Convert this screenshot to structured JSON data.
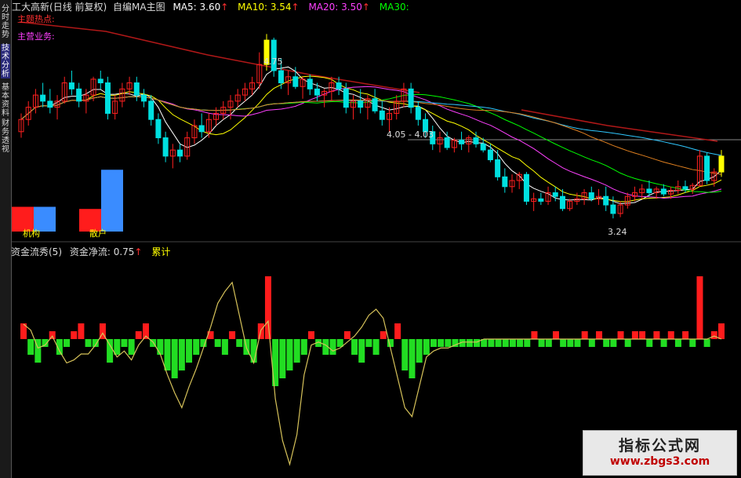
{
  "sidebar": {
    "tabs": [
      "分时走势",
      "技术分析",
      "基本资料",
      "财务透视"
    ]
  },
  "header": {
    "stock": "工大高新",
    "period": "(日线 前复权)",
    "indicator": "自编MA主图",
    "ma": [
      {
        "name": "MA5:",
        "value": "3.60",
        "arrow": "↑",
        "color": "#ffffff"
      },
      {
        "name": "MA10:",
        "value": "3.54",
        "arrow": "↑",
        "color": "#ffff00"
      },
      {
        "name": "MA20:",
        "value": "3.50",
        "arrow": "↑",
        "color": "#ff40ff"
      },
      {
        "name": "MA30:",
        "value": "",
        "arrow": "",
        "color": "#00ff00"
      }
    ]
  },
  "notes": {
    "line1": "主题热点:",
    "line2": "主营业务:"
  },
  "price_labels": {
    "high": "4.75",
    "mid": "4.05 - 4.03",
    "low": "3.24"
  },
  "volume_legend": {
    "institution": "机构",
    "retail": "散户"
  },
  "lower_header": {
    "title": "资金流秀(5)",
    "net_label": "资金净流:",
    "net_value": "0.75",
    "arrow": "↑",
    "cum_label": "累计"
  },
  "watermark": {
    "line1": "指标公式网",
    "line2": "www.zbgs3.com"
  },
  "colors": {
    "up": "#ff2020",
    "down": "#00e0e0",
    "flow_pos": "#ff1c1c",
    "flow_neg": "#22dd22",
    "cum": "#d6c25a"
  },
  "chart_data": {
    "type": "candlestick",
    "annotations": {
      "high": 4.75,
      "low": 3.24
    },
    "sidebar_bars": {
      "institution": [
        0.45,
        0.45
      ],
      "retail": [
        0.3,
        0.82
      ]
    },
    "candles_ohlc": [
      [
        3.95,
        4.1,
        3.9,
        4.05
      ],
      [
        4.05,
        4.2,
        4.0,
        4.15
      ],
      [
        4.15,
        4.3,
        4.1,
        4.25
      ],
      [
        4.25,
        4.35,
        4.15,
        4.2
      ],
      [
        4.2,
        4.3,
        4.1,
        4.15
      ],
      [
        4.15,
        4.25,
        4.05,
        4.2
      ],
      [
        4.2,
        4.4,
        4.18,
        4.35
      ],
      [
        4.35,
        4.45,
        4.25,
        4.3
      ],
      [
        4.3,
        4.35,
        4.15,
        4.2
      ],
      [
        4.2,
        4.3,
        4.1,
        4.25
      ],
      [
        4.25,
        4.4,
        4.2,
        4.38
      ],
      [
        4.38,
        4.45,
        4.3,
        4.35
      ],
      [
        4.35,
        4.4,
        4.05,
        4.1
      ],
      [
        4.1,
        4.25,
        4.05,
        4.2
      ],
      [
        4.2,
        4.35,
        4.15,
        4.3
      ],
      [
        4.3,
        4.4,
        4.25,
        4.35
      ],
      [
        4.35,
        4.4,
        4.2,
        4.25
      ],
      [
        4.25,
        4.3,
        4.15,
        4.2
      ],
      [
        4.2,
        4.25,
        4.0,
        4.05
      ],
      [
        4.05,
        4.1,
        3.85,
        3.9
      ],
      [
        3.9,
        3.95,
        3.7,
        3.75
      ],
      [
        3.75,
        3.85,
        3.65,
        3.8
      ],
      [
        3.8,
        3.85,
        3.7,
        3.75
      ],
      [
        3.75,
        3.95,
        3.72,
        3.9
      ],
      [
        3.9,
        4.05,
        3.85,
        4.0
      ],
      [
        4.0,
        4.1,
        3.9,
        3.95
      ],
      [
        3.95,
        4.1,
        3.9,
        4.05
      ],
      [
        4.05,
        4.15,
        4.0,
        4.1
      ],
      [
        4.1,
        4.2,
        4.05,
        4.15
      ],
      [
        4.15,
        4.25,
        4.05,
        4.2
      ],
      [
        4.2,
        4.3,
        4.15,
        4.25
      ],
      [
        4.25,
        4.35,
        4.2,
        4.3
      ],
      [
        4.3,
        4.4,
        4.25,
        4.35
      ],
      [
        4.35,
        4.6,
        4.3,
        4.5
      ],
      [
        4.5,
        4.75,
        4.45,
        4.7
      ],
      [
        4.7,
        4.72,
        4.4,
        4.45
      ],
      [
        4.45,
        4.55,
        4.3,
        4.35
      ],
      [
        4.35,
        4.45,
        4.25,
        4.4
      ],
      [
        4.4,
        4.48,
        4.3,
        4.32
      ],
      [
        4.32,
        4.4,
        4.22,
        4.38
      ],
      [
        4.38,
        4.42,
        4.25,
        4.3
      ],
      [
        4.3,
        4.35,
        4.2,
        4.25
      ],
      [
        4.25,
        4.3,
        4.15,
        4.28
      ],
      [
        4.28,
        4.4,
        4.2,
        4.35
      ],
      [
        4.35,
        4.4,
        4.25,
        4.3
      ],
      [
        4.3,
        4.35,
        4.1,
        4.15
      ],
      [
        4.15,
        4.25,
        4.05,
        4.2
      ],
      [
        4.2,
        4.3,
        4.1,
        4.15
      ],
      [
        4.15,
        4.25,
        4.05,
        4.22
      ],
      [
        4.22,
        4.3,
        4.1,
        4.12
      ],
      [
        4.12,
        4.2,
        4.0,
        4.05
      ],
      [
        4.05,
        4.15,
        3.95,
        4.1
      ],
      [
        4.1,
        4.25,
        4.05,
        4.2
      ],
      [
        4.2,
        4.35,
        4.15,
        4.3
      ],
      [
        4.3,
        4.35,
        4.1,
        4.15
      ],
      [
        4.15,
        4.2,
        4.0,
        4.05
      ],
      [
        4.05,
        4.1,
        3.9,
        3.95
      ],
      [
        3.95,
        4.0,
        3.8,
        3.85
      ],
      [
        3.85,
        3.95,
        3.78,
        3.9
      ],
      [
        3.9,
        3.95,
        3.8,
        3.82
      ],
      [
        3.82,
        3.9,
        3.78,
        3.88
      ],
      [
        3.88,
        3.95,
        3.8,
        3.85
      ],
      [
        3.85,
        3.92,
        3.78,
        3.9
      ],
      [
        3.9,
        3.95,
        3.82,
        3.85
      ],
      [
        3.85,
        3.9,
        3.78,
        3.8
      ],
      [
        3.8,
        3.85,
        3.7,
        3.72
      ],
      [
        3.72,
        3.8,
        3.55,
        3.58
      ],
      [
        3.58,
        3.65,
        3.45,
        3.5
      ],
      [
        3.5,
        3.6,
        3.45,
        3.55
      ],
      [
        3.55,
        3.62,
        3.48,
        3.6
      ],
      [
        3.6,
        3.62,
        3.35,
        3.38
      ],
      [
        3.38,
        3.45,
        3.3,
        3.4
      ],
      [
        3.4,
        3.45,
        3.35,
        3.38
      ],
      [
        3.38,
        3.5,
        3.35,
        3.45
      ],
      [
        3.45,
        3.5,
        3.38,
        3.42
      ],
      [
        3.42,
        3.48,
        3.3,
        3.32
      ],
      [
        3.32,
        3.4,
        3.3,
        3.38
      ],
      [
        3.38,
        3.45,
        3.35,
        3.4
      ],
      [
        3.4,
        3.48,
        3.35,
        3.45
      ],
      [
        3.45,
        3.5,
        3.38,
        3.4
      ],
      [
        3.4,
        3.48,
        3.35,
        3.42
      ],
      [
        3.42,
        3.5,
        3.3,
        3.35
      ],
      [
        3.35,
        3.42,
        3.24,
        3.28
      ],
      [
        3.28,
        3.38,
        3.25,
        3.35
      ],
      [
        3.35,
        3.45,
        3.32,
        3.42
      ],
      [
        3.42,
        3.5,
        3.38,
        3.45
      ],
      [
        3.45,
        3.52,
        3.4,
        3.48
      ],
      [
        3.48,
        3.55,
        3.42,
        3.45
      ],
      [
        3.45,
        3.5,
        3.4,
        3.48
      ],
      [
        3.48,
        3.52,
        3.42,
        3.44
      ],
      [
        3.44,
        3.5,
        3.4,
        3.47
      ],
      [
        3.47,
        3.55,
        3.44,
        3.5
      ],
      [
        3.5,
        3.55,
        3.45,
        3.48
      ],
      [
        3.48,
        3.53,
        3.44,
        3.51
      ],
      [
        3.51,
        3.8,
        3.5,
        3.75
      ],
      [
        3.75,
        3.78,
        3.52,
        3.55
      ],
      [
        3.55,
        3.65,
        3.5,
        3.62
      ],
      [
        3.62,
        3.8,
        3.58,
        3.75
      ]
    ],
    "flow_values": [
      2,
      -2,
      -3,
      -1,
      1,
      -2,
      -1,
      1,
      2,
      -1,
      -1,
      2,
      -3,
      -2,
      -1,
      -2,
      1,
      2,
      -1,
      -2,
      -4,
      -5,
      -4,
      -3,
      -2,
      -1,
      1,
      -1,
      -2,
      1,
      -1,
      -2,
      -3,
      2,
      8,
      -6,
      -5,
      -4,
      -3,
      -2,
      1,
      -1,
      -2,
      -2,
      -1,
      1,
      -2,
      -3,
      -1,
      -2,
      1,
      -1,
      2,
      -4,
      -5,
      -3,
      -2,
      -1,
      -1,
      -1,
      -1,
      -1,
      -1,
      -1,
      -1,
      -1,
      -1,
      -1,
      -1,
      -1,
      -1,
      1,
      -1,
      -1,
      1,
      -1,
      -1,
      -1,
      1,
      -1,
      1,
      -1,
      -1,
      1,
      -1,
      1,
      1,
      -1,
      1,
      -1,
      1,
      -1,
      1,
      -1,
      8,
      -1,
      1,
      2
    ],
    "cum_values": [
      0.5,
      0.3,
      -0.3,
      -0.2,
      0.1,
      -0.4,
      -0.8,
      -0.7,
      -0.5,
      -0.5,
      -0.2,
      0.2,
      -0.2,
      -0.6,
      -0.4,
      -0.7,
      -0.2,
      0.1,
      -0.1,
      -0.5,
      -1.2,
      -1.8,
      -2.3,
      -1.6,
      -1.0,
      -0.3,
      0.4,
      1.2,
      1.6,
      1.9,
      0.8,
      -0.3,
      -0.8,
      0.3,
      0.6,
      -2.0,
      -3.4,
      -4.2,
      -3.2,
      -1.2,
      -0.2,
      -0.1,
      -0.2,
      -0.4,
      -0.3,
      -0.1,
      0.1,
      0.4,
      0.8,
      1.0,
      0.7,
      -0.3,
      -1.3,
      -2.3,
      -2.6,
      -1.6,
      -0.6,
      -0.4,
      -0.3,
      -0.3,
      -0.2,
      -0.1,
      -0.1,
      -0.1,
      0.0,
      0.0,
      0.0,
      0.0,
      0.0,
      0.0,
      0.0,
      0.0,
      0.0,
      0.0,
      0.0,
      0.0,
      0.0,
      0.0,
      0.0,
      0.0,
      0.0,
      0.0,
      0.0,
      0.0,
      0.0,
      0.0,
      0.0,
      0.0,
      0.0,
      0.0,
      0.0,
      0.0,
      0.0,
      0.0,
      0.0,
      0.0,
      0.1,
      0.0
    ],
    "ylim_price": [
      3.1,
      4.9
    ]
  }
}
